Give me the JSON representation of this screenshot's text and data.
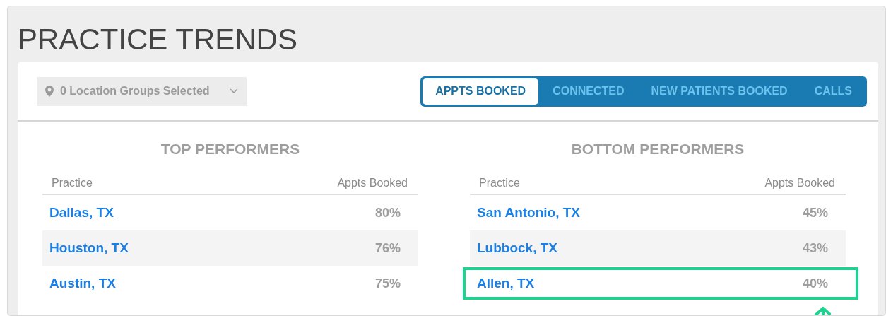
{
  "title": "PRACTICE TRENDS",
  "location_filter": {
    "value": "0 Location Groups Selected"
  },
  "tabs": [
    {
      "label": "APPTS BOOKED",
      "selected": true
    },
    {
      "label": "CONNECTED",
      "selected": false
    },
    {
      "label": "NEW PATIENTS BOOKED",
      "selected": false
    },
    {
      "label": "CALLS",
      "selected": false
    }
  ],
  "panels": [
    {
      "heading": "TOP PERFORMERS",
      "columns": [
        "Practice",
        "Appts Booked"
      ],
      "rows": [
        {
          "practice": "Dallas, TX",
          "value": "80%",
          "highlighted": false
        },
        {
          "practice": "Houston, TX",
          "value": "76%",
          "highlighted": false
        },
        {
          "practice": "Austin, TX",
          "value": "75%",
          "highlighted": false
        }
      ]
    },
    {
      "heading": "BOTTOM PERFORMERS",
      "columns": [
        "Practice",
        "Appts Booked"
      ],
      "rows": [
        {
          "practice": "San Antonio, TX",
          "value": "45%",
          "highlighted": false
        },
        {
          "practice": "Lubbock, TX",
          "value": "43%",
          "highlighted": false
        },
        {
          "practice": "Allen, TX",
          "value": "40%",
          "highlighted": true
        }
      ]
    }
  ]
}
